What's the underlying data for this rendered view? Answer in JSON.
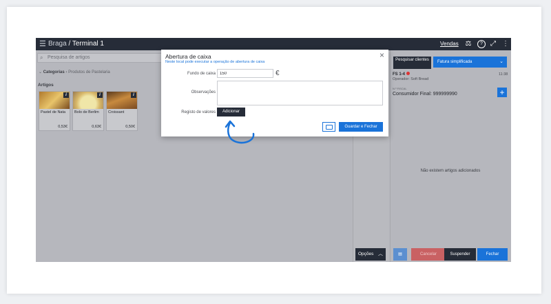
{
  "header": {
    "store": "Braga",
    "separator": "/",
    "terminal": "Terminal 1",
    "vendas": "Vendas",
    "help": "?"
  },
  "search": {
    "placeholder": "Pesquisa de artigos"
  },
  "breadcrumb": {
    "root": "Categorias",
    "current": "Produtos de Pastelaria"
  },
  "artigos_label": "Artigos",
  "products": [
    {
      "name": "Pastel de Nata",
      "price": "0,53€"
    },
    {
      "name": "Bolo de Berlim",
      "price": "0,63€"
    },
    {
      "name": "Croissant",
      "price": "0,50€"
    }
  ],
  "opcoes": "Opções",
  "right_panel": {
    "pesquisar": "Pesquisar clientes",
    "doc_type": "Fatura simplificada",
    "doc_number": "FS 1-4",
    "doc_time": "11:38",
    "operador": "Operador: Soft Bread",
    "nif_label": "N.º FISCAL",
    "cliente": "Consumidor Final: 999999990",
    "empty": "Não existem artigos adicionados",
    "cancelar": "Cancelar",
    "suspender": "Suspender",
    "fechar": "Fechar"
  },
  "modal": {
    "title": "Abertura de caixa",
    "subtitle": "Neste local pode executar a operação de abertura de caixa",
    "fundo_label": "Fundo de caixa",
    "fundo_value": "150",
    "currency": "€",
    "observacoes_label": "Observações",
    "registo_label": "Registo de valores",
    "adicionar": "Adicionar",
    "guardar": "Guardar e Fechar",
    "close": "×"
  },
  "colors": {
    "primary": "#1a73d9",
    "dark": "#262c38",
    "danger": "#c96163",
    "overlay": "#b6b7bd"
  }
}
